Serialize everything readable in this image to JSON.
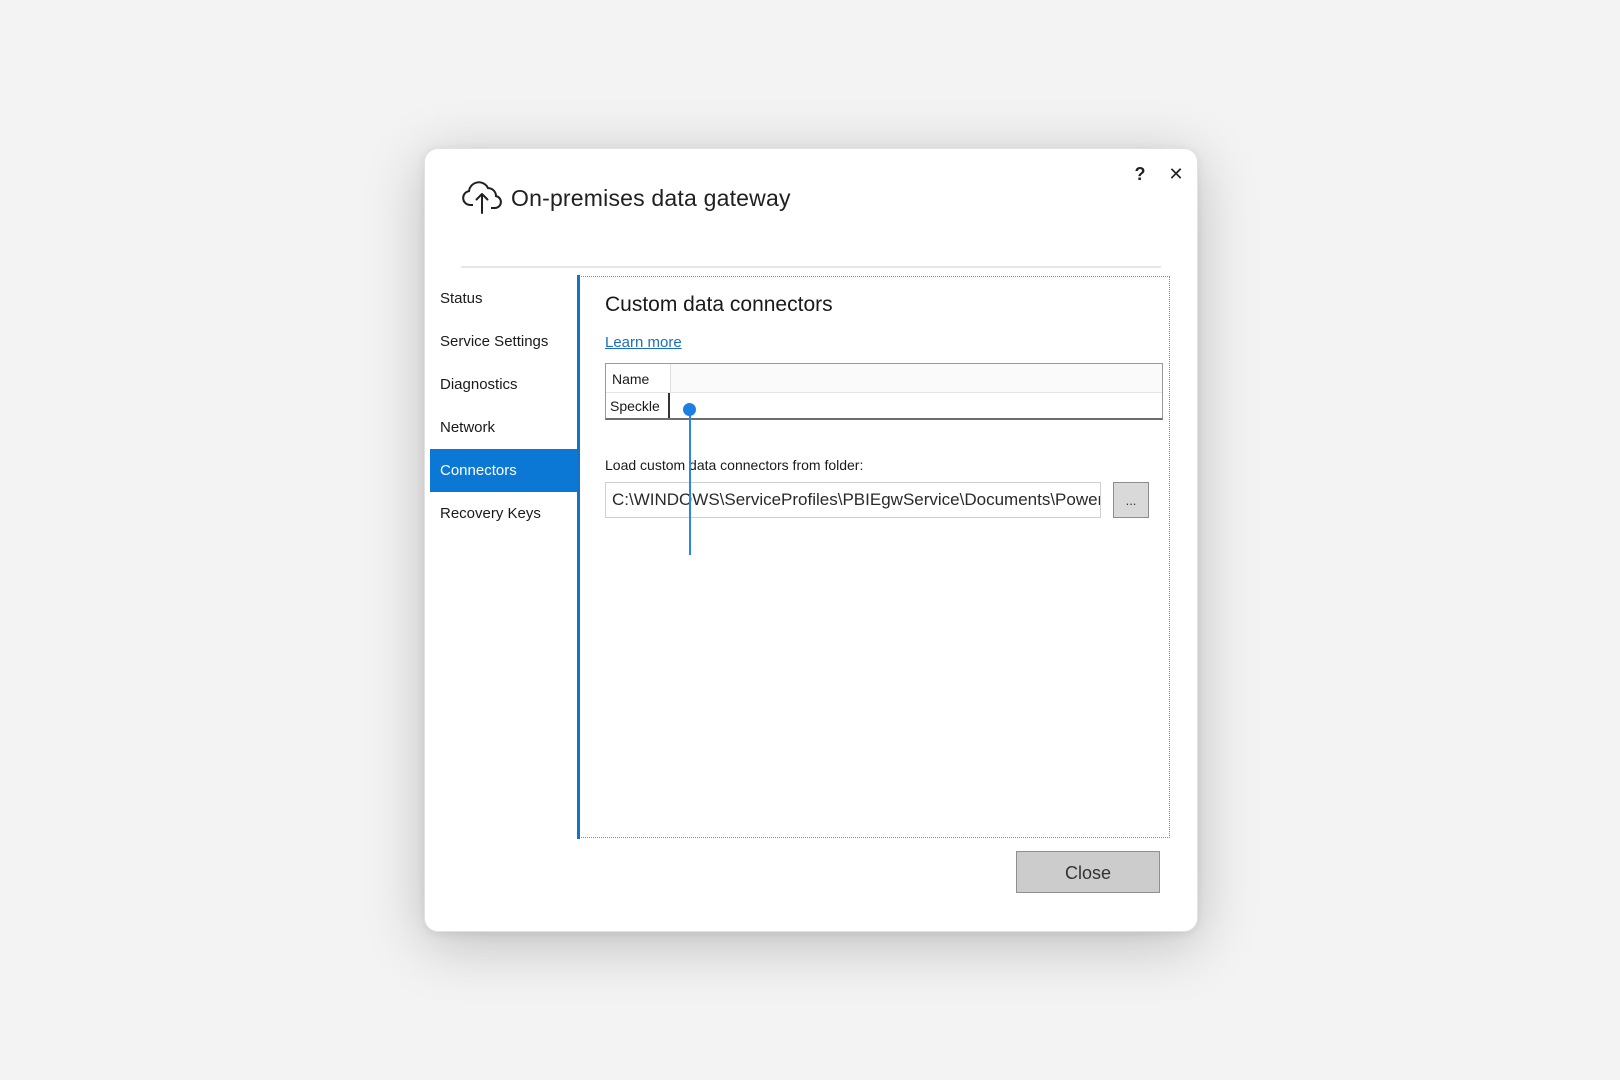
{
  "dialog": {
    "title": "On-premises data gateway",
    "help_label": "?",
    "close_x_label": "✕",
    "title_icon": "cloud-upload-icon"
  },
  "nav": {
    "items": [
      {
        "label": "Status"
      },
      {
        "label": "Service Settings"
      },
      {
        "label": "Diagnostics"
      },
      {
        "label": "Network"
      },
      {
        "label": "Connectors",
        "active": true
      },
      {
        "label": "Recovery Keys"
      }
    ]
  },
  "content": {
    "heading": "Custom data connectors",
    "learn_more": "Learn more",
    "grid": {
      "columns": [
        "Name"
      ],
      "rows": [
        [
          "Speckle"
        ]
      ]
    },
    "folder_label": "Load custom data connectors from folder:",
    "folder_value": "C:\\WINDOWS\\ServiceProfiles\\PBIEgwService\\Documents\\Power BI Desktop\\Custom Connectors",
    "browse_label": "..."
  },
  "footer": {
    "close_label": "Close"
  },
  "colors": {
    "accent": "#0c78d6",
    "link": "#1b6ec2",
    "cursor": "#1f7fe0"
  }
}
